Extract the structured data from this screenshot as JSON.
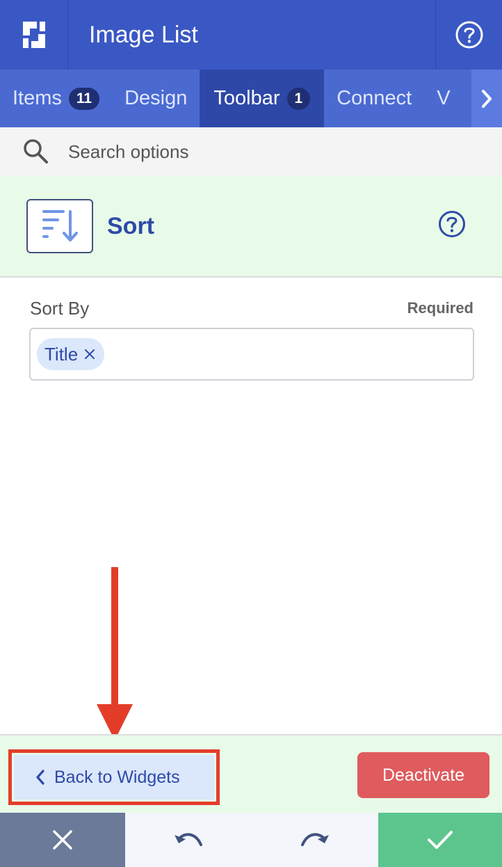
{
  "header": {
    "title": "Image List",
    "logo_icon": "brand-logo-icon",
    "help_icon": "question-circle-icon"
  },
  "tabs": [
    {
      "label": "Items",
      "badge": "11",
      "active": false
    },
    {
      "label": "Design",
      "badge": null,
      "active": false
    },
    {
      "label": "Toolbar",
      "badge": "1",
      "active": true
    },
    {
      "label": "Connect",
      "badge": null,
      "active": false
    },
    {
      "label": "V",
      "badge": null,
      "active": false
    }
  ],
  "search": {
    "placeholder": "Search options"
  },
  "widget": {
    "title": "Sort",
    "icon": "sort-descending-icon"
  },
  "field": {
    "label": "Sort By",
    "required_text": "Required",
    "chips": [
      "Title"
    ]
  },
  "actions": {
    "back_label": "Back to Widgets",
    "deactivate_label": "Deactivate"
  },
  "footer": {
    "icons": [
      "close-icon",
      "undo-icon",
      "redo-icon",
      "check-icon"
    ]
  },
  "colors": {
    "header": "#3a58c4",
    "tab_active": "#2e48a8",
    "accent_blue": "#2e4aa8",
    "panel_green": "#e8fbe8",
    "danger": "#df5b5e",
    "annotation": "#e33d2a",
    "confirm": "#5cc58e"
  }
}
